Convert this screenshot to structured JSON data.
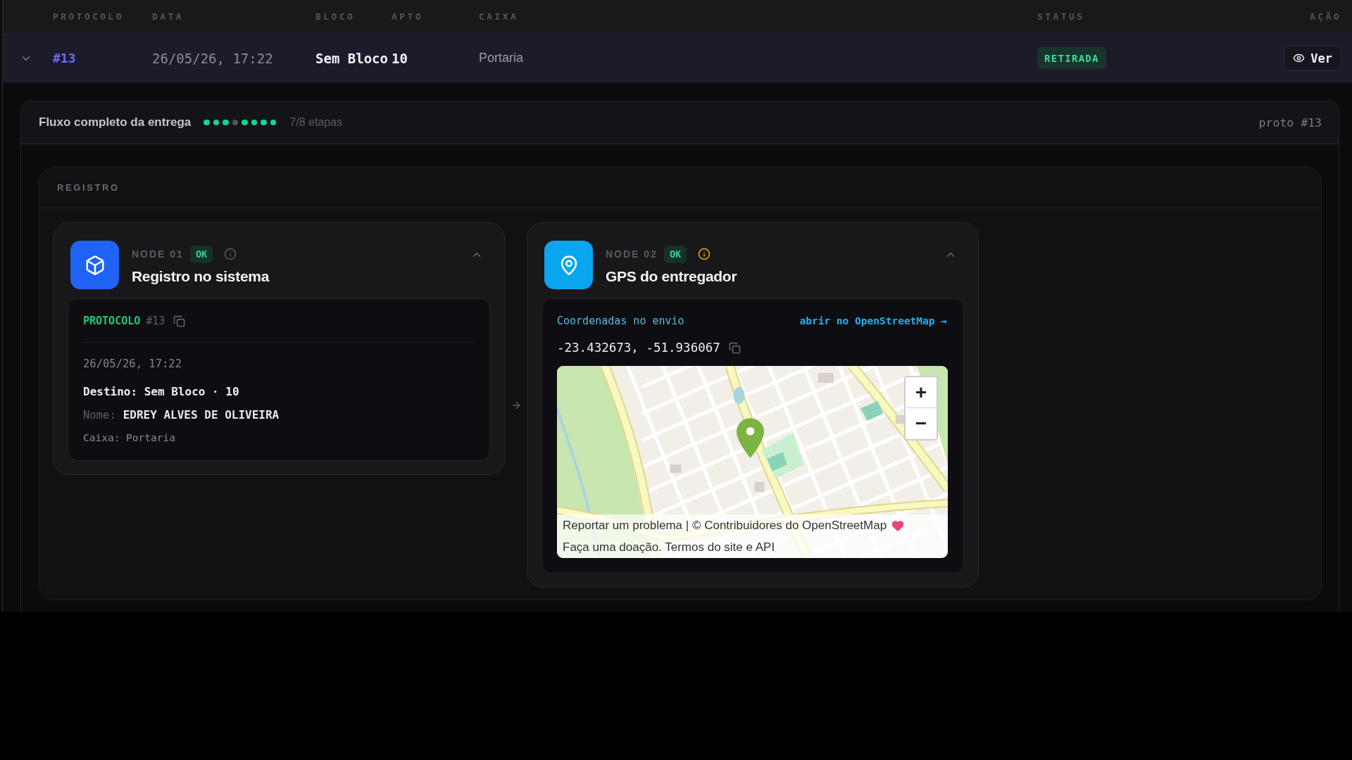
{
  "table": {
    "columns": [
      "PROTOCOLO",
      "DATA",
      "BLOCO",
      "APTO",
      "CAIXA",
      "STATUS",
      "AÇÃO"
    ],
    "rows": [
      {
        "expanded": true,
        "protocol": "#13",
        "date": "26/05/26, 17:22",
        "block": "Sem Bloco",
        "apartment": "10",
        "box": "Portaria",
        "status": "RETIRADA",
        "action": "Ver"
      }
    ]
  },
  "flow": {
    "title": "Fluxo completo da entrega",
    "steps": [
      {
        "done": true
      },
      {
        "done": true
      },
      {
        "done": true
      },
      {
        "done": false
      },
      {
        "done": true
      },
      {
        "done": true
      },
      {
        "done": true
      },
      {
        "done": true
      }
    ],
    "progress": "7/8 etapas",
    "reference": "proto #13",
    "section": {
      "title": "REGISTRO",
      "nodes": [
        {
          "kind": "registro",
          "label": "NODE 01",
          "status": "OK",
          "warning": false,
          "color": "#1f63f7",
          "title": "Registro no sistema",
          "expanded": true,
          "protocol_label": "PROTOCOLO",
          "protocol": "#13",
          "date": "26/05/26, 17:22",
          "destination": "Destino: Sem Bloco · 10",
          "name_label": "Nome:",
          "name": "EDREY ALVES DE OLIVEIRA",
          "box": "Caixa: Portaria"
        },
        {
          "kind": "gps",
          "label": "NODE 02",
          "status": "OK",
          "warning": true,
          "color": "#0aa5ef",
          "title": "GPS do entregador",
          "expanded": true,
          "coordinates_label": "Coordenadas no envio",
          "map_link": "abrir no OpenStreetMap →",
          "coordinates": "-23.432673, -51.936067",
          "map": {
            "zoom_in": "+",
            "zoom_out": "−",
            "attribution": [
              "Reportar um problema | © Contribuidores do OpenStreetMap",
              "Faça uma doação. Termos do site e API"
            ]
          }
        }
      ]
    }
  }
}
